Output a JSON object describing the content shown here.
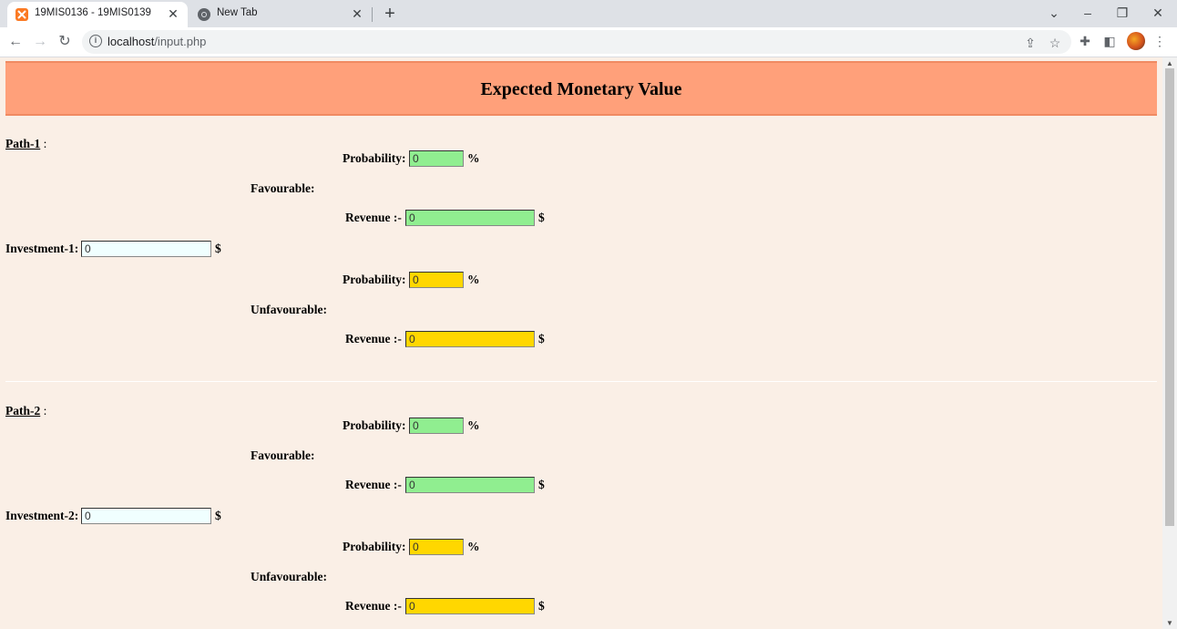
{
  "browser": {
    "tabs": [
      {
        "title": "19MIS0136 - 19MIS0139",
        "icon": "xampp-icon",
        "active": true
      },
      {
        "title": "New Tab",
        "icon": "chrome-icon",
        "active": false
      }
    ],
    "url_host": "localhost",
    "url_path": "/input.php"
  },
  "page": {
    "title": "Expected Monetary Value",
    "colors": {
      "header_bg": "#ffa07a",
      "page_bg": "#faefe6",
      "favourable_input": "#90ee90",
      "unfavourable_input": "#ffd700",
      "investment_input": "#f0ffff"
    },
    "paths": [
      {
        "label": "Path-1",
        "label_suffix": " :",
        "investment_label": "Investment-1:",
        "investment_value": "0",
        "investment_unit": "$",
        "favourable": {
          "label": "Favourable:",
          "probability_label": "Probability:",
          "probability_value": "0",
          "probability_unit": "%",
          "revenue_label": "Revenue :-",
          "revenue_value": "0",
          "revenue_unit": "$"
        },
        "unfavourable": {
          "label": "Unfavourable:",
          "probability_label": "Probability:",
          "probability_value": "0",
          "probability_unit": "%",
          "revenue_label": "Revenue :-",
          "revenue_value": "0",
          "revenue_unit": "$"
        }
      },
      {
        "label": "Path-2",
        "label_suffix": " :",
        "investment_label": "Investment-2:",
        "investment_value": "0",
        "investment_unit": "$",
        "favourable": {
          "label": "Favourable:",
          "probability_label": "Probability:",
          "probability_value": "0",
          "probability_unit": "%",
          "revenue_label": "Revenue :-",
          "revenue_value": "0",
          "revenue_unit": "$"
        },
        "unfavourable": {
          "label": "Unfavourable:",
          "probability_label": "Probability:",
          "probability_value": "0",
          "probability_unit": "%",
          "revenue_label": "Revenue :-",
          "revenue_value": "0",
          "revenue_unit": "$"
        }
      }
    ]
  }
}
